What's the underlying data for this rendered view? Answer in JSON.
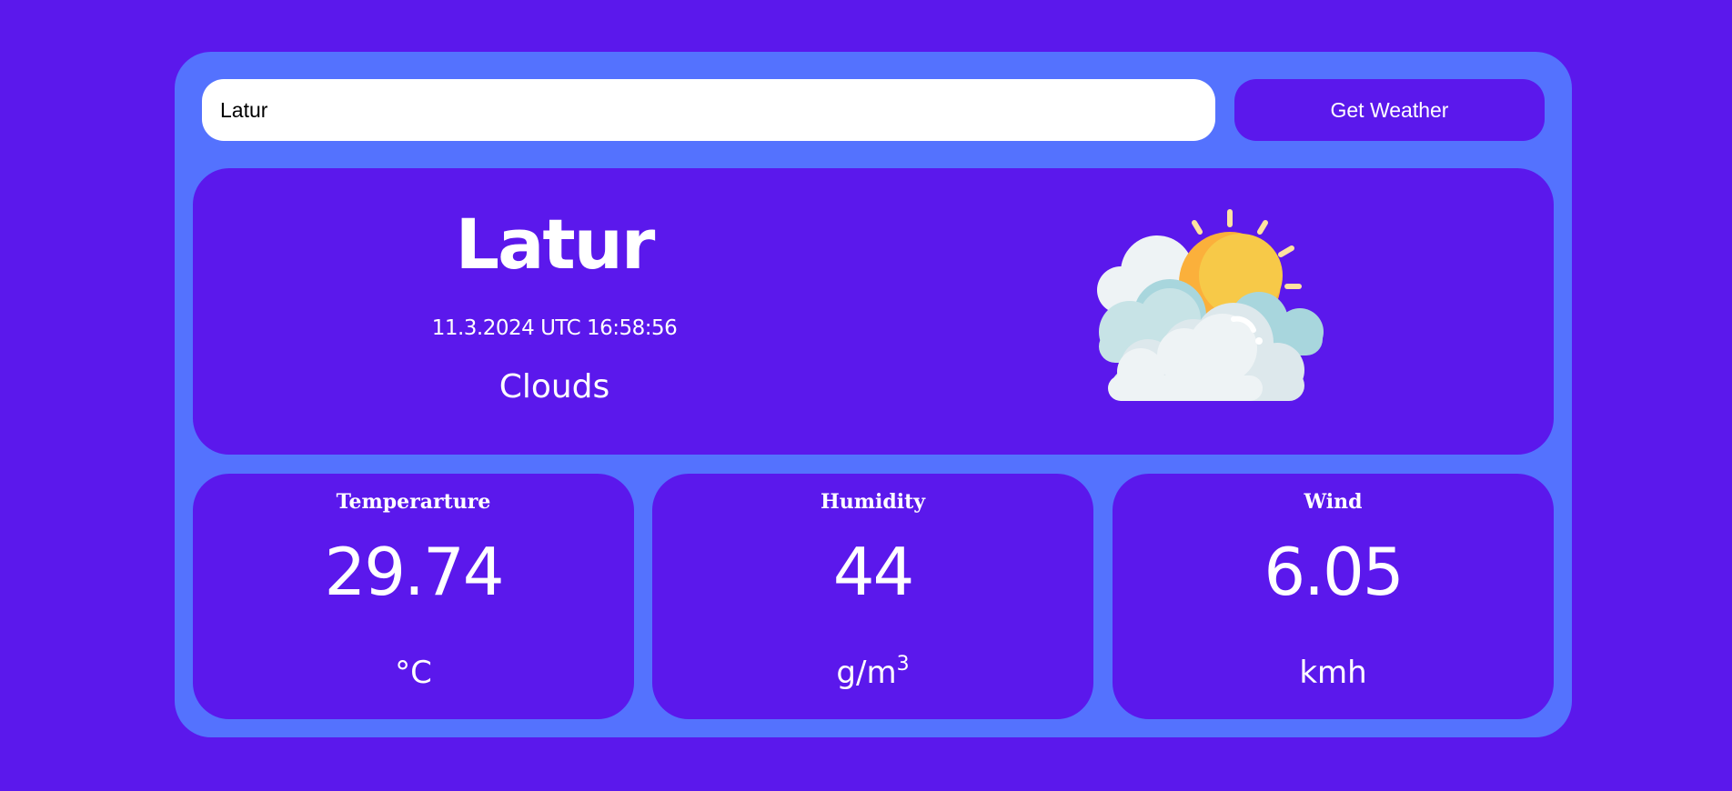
{
  "search": {
    "value": "Latur",
    "button_label": "Get Weather"
  },
  "current": {
    "city": "Latur",
    "datetime": "11.3.2024 UTC 16:58:56",
    "condition": "Clouds",
    "icon": "sun-behind-clouds-icon"
  },
  "stats": {
    "temperature": {
      "label": "Temperarture",
      "value": "29.74",
      "unit": "°C"
    },
    "humidity": {
      "label": "Humidity",
      "value": "44",
      "unit_base": "g/m",
      "unit_exp": "3"
    },
    "wind": {
      "label": "Wind",
      "value": "6.05",
      "unit": "kmh"
    }
  },
  "colors": {
    "background": "#5b18ec",
    "container": "#5472fe",
    "card": "#5b18ec",
    "text": "#ffffff",
    "sun": "#f7c948",
    "sun_shade": "#fbb03b",
    "sun_rays": "#fde2a1",
    "cloud_light": "#eef3f5",
    "cloud_blue": "#a8d6dd"
  }
}
